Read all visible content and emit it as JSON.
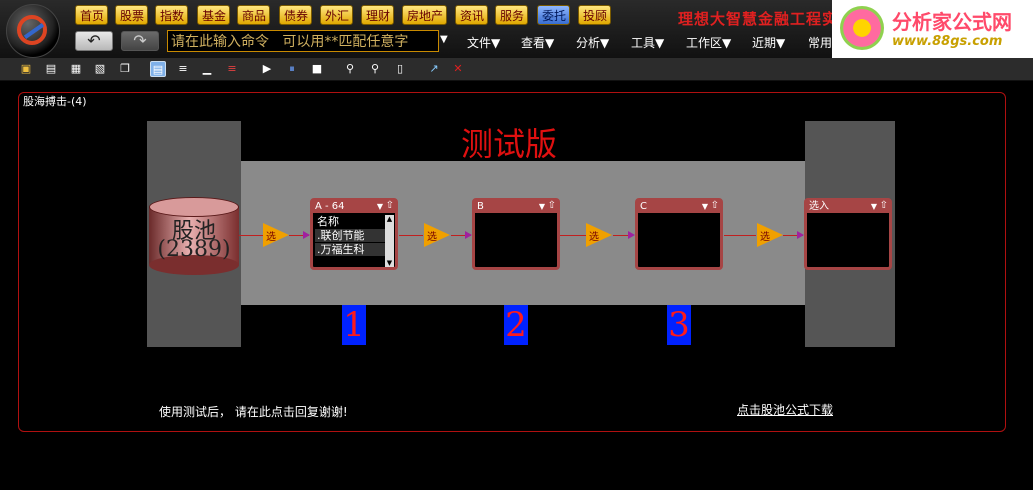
{
  "nav": [
    "首页",
    "股票",
    "指数",
    "基金",
    "商品",
    "债券",
    "外汇",
    "理财",
    "房地产",
    "资讯",
    "服务",
    "委托",
    "投顾"
  ],
  "nav_active_index": 11,
  "brand": {
    "text": "理想大智慧金融工程实验",
    "logo_name": "分析家公式网",
    "logo_url": "www.88gs.com"
  },
  "command": {
    "value": "请在此输入命令   可以用**匹配任意字"
  },
  "menus": [
    "文件▼",
    "查看▼",
    "分析▼",
    "工具▼",
    "工作区▼",
    "近期▼",
    "常用"
  ],
  "panel": {
    "title": "股海搏击-(4)",
    "watermark": "测试版",
    "pool": {
      "name": "股池",
      "count": "(2389)"
    },
    "filter_label": "选",
    "boxes": [
      {
        "title": "A - 64",
        "header": "名称",
        "rows": [
          ".联创节能",
          ".万福生科"
        ]
      },
      {
        "title": "B",
        "header": "",
        "rows": []
      },
      {
        "title": "C",
        "header": "",
        "rows": []
      },
      {
        "title": "选入",
        "header": "",
        "rows": []
      }
    ],
    "step_numbers": [
      "1",
      "2",
      "3"
    ],
    "footer_left": "使用测试后， 请在此点击回复谢谢!",
    "footer_right": "点击股池公式下载"
  }
}
